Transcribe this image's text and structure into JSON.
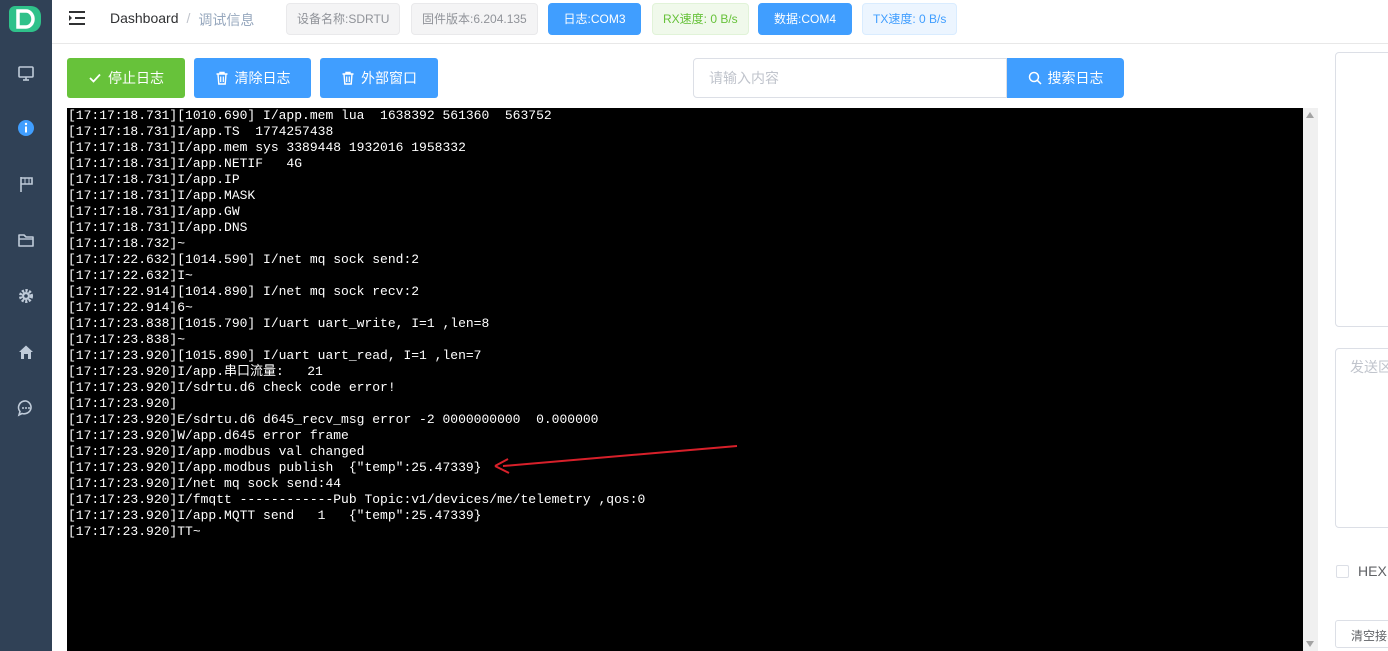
{
  "header": {
    "breadcrumb_home": "Dashboard",
    "breadcrumb_sep": "/",
    "breadcrumb_current": "调试信息",
    "tags": {
      "device_name": "设备名称:SDRTU",
      "firmware": "固件版本:6.204.135",
      "log_port": "日志:COM3",
      "rx_speed": "RX速度: 0 B/s",
      "data_port": "数据:COM4",
      "tx_speed": "TX速度: 0 B/s"
    }
  },
  "sidebar": {
    "icons": [
      "monitor-icon",
      "info-icon",
      "flag-icon",
      "folder-icon",
      "gear-icon",
      "home-icon",
      "chat-icon"
    ],
    "active_index": 1
  },
  "toolbar": {
    "stop_log": "停止日志",
    "clear_log": "清除日志",
    "external_window": "外部窗口",
    "search_placeholder": "请输入内容",
    "search_value": "",
    "search_log": "搜索日志"
  },
  "console": {
    "lines": [
      "[17:17:18.731][1010.690] I/app.mem lua  1638392 561360  563752",
      "[17:17:18.731]I/app.TS  1774257438",
      "[17:17:18.731]I/app.mem sys 3389448 1932016 1958332",
      "[17:17:18.731]I/app.NETIF   4G",
      "[17:17:18.731]I/app.IP",
      "[17:17:18.731]I/app.MASK",
      "[17:17:18.731]I/app.GW",
      "[17:17:18.731]I/app.DNS",
      "[17:17:18.732]~",
      "[17:17:22.632][1014.590] I/net mq sock send:2",
      "[17:17:22.632]I~",
      "[17:17:22.914][1014.890] I/net mq sock recv:2",
      "[17:17:22.914]6~",
      "[17:17:23.838][1015.790] I/uart uart_write, I=1 ,len=8",
      "[17:17:23.838]~",
      "[17:17:23.920][1015.890] I/uart uart_read, I=1 ,len=7",
      "[17:17:23.920]I/app.串口流量:   21",
      "[17:17:23.920]I/sdrtu.d6 check code error!",
      "[17:17:23.920]",
      "[17:17:23.920]E/sdrtu.d6 d645_recv_msg error -2 0000000000  0.000000",
      "[17:17:23.920]W/app.d645 error frame",
      "[17:17:23.920]I/app.modbus val changed",
      "[17:17:23.920]I/app.modbus publish  {\"temp\":25.47339}",
      "[17:17:23.920]I/net mq sock send:44",
      "[17:17:23.920]I/fmqtt ------------Pub Topic:v1/devices/me/telemetry ,qos:0",
      "[17:17:23.920]I/app.MQTT send   1   {\"temp\":25.47339}",
      "[17:17:23.920]TT~"
    ],
    "annotation_color": "#d8202a"
  },
  "right_panel": {
    "send_placeholder": "发送区",
    "hex_label": "HEX",
    "clear_receive": "清空接收"
  },
  "colors": {
    "sidebar_bg": "#304156",
    "primary": "#409eff",
    "success": "#67c23a",
    "logo": "#2fc18a"
  }
}
